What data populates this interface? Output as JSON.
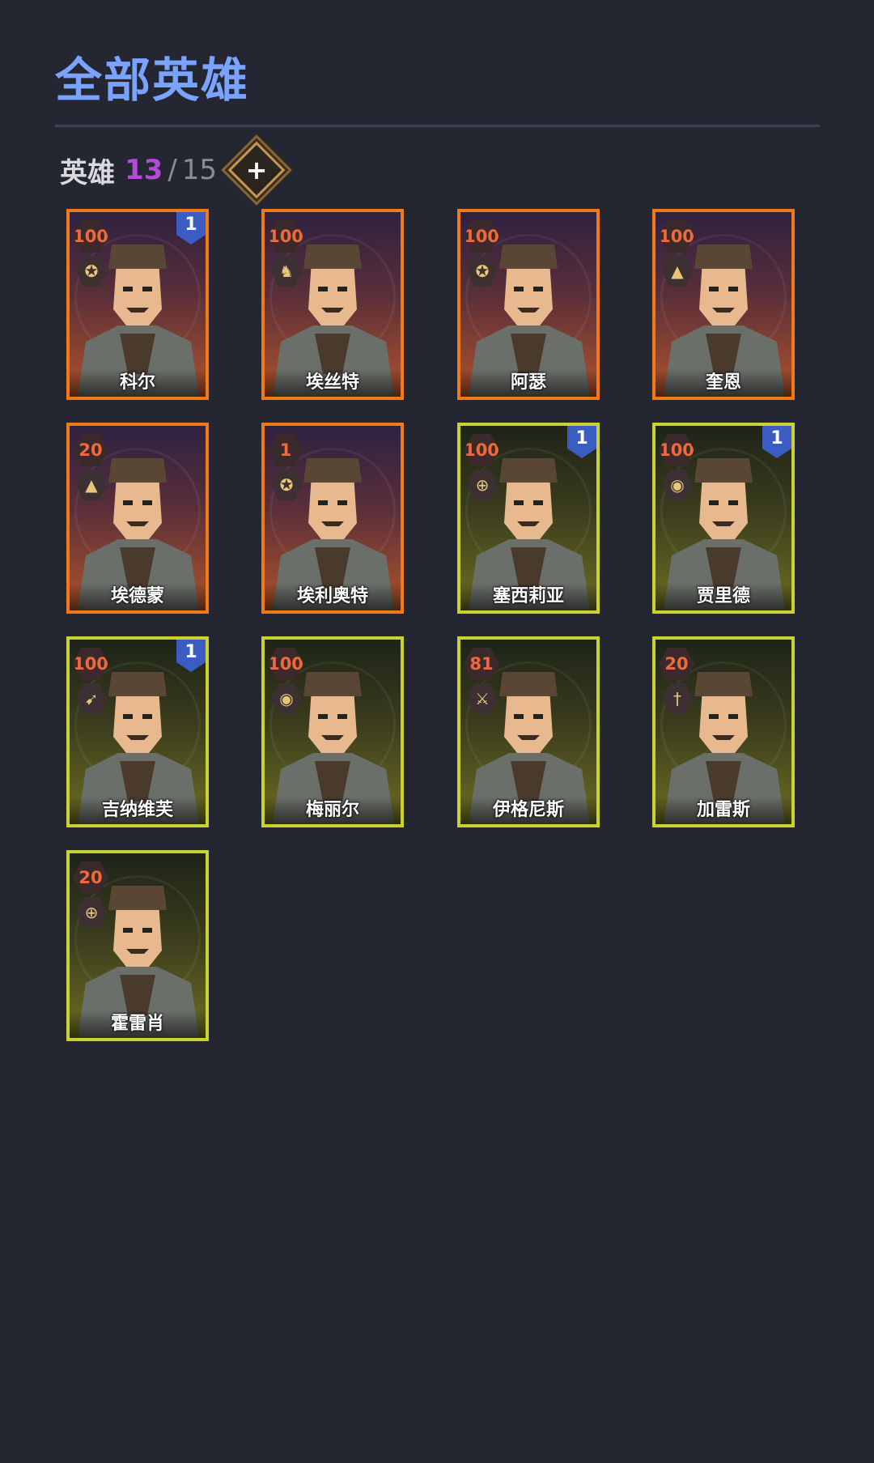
{
  "header": {
    "title": "全部英雄"
  },
  "roster": {
    "label": "英雄",
    "current": "13",
    "separator": "/",
    "max": "15",
    "add_icon": "plus-diamond-icon"
  },
  "heroes": [
    {
      "name": "科尔",
      "level": "100",
      "rarity": "orange",
      "class_icon": "pentagram-icon",
      "badge": "1"
    },
    {
      "name": "埃丝特",
      "level": "100",
      "rarity": "orange",
      "class_icon": "horse-icon",
      "badge": ""
    },
    {
      "name": "阿瑟",
      "level": "100",
      "rarity": "orange",
      "class_icon": "pentagram-icon",
      "badge": ""
    },
    {
      "name": "奎恩",
      "level": "100",
      "rarity": "orange",
      "class_icon": "wizard-hat-icon",
      "badge": ""
    },
    {
      "name": "埃德蒙",
      "level": "20",
      "rarity": "orange",
      "class_icon": "wizard-hat-icon",
      "badge": ""
    },
    {
      "name": "埃利奥特",
      "level": "1",
      "rarity": "orange",
      "class_icon": "pentagram-icon",
      "badge": ""
    },
    {
      "name": "塞西莉亚",
      "level": "100",
      "rarity": "green",
      "class_icon": "cross-icon",
      "badge": "1"
    },
    {
      "name": "贾里德",
      "level": "100",
      "rarity": "green",
      "class_icon": "eye-icon",
      "badge": "1"
    },
    {
      "name": "吉纳维芙",
      "level": "100",
      "rarity": "green",
      "class_icon": "arrows-icon",
      "badge": "1"
    },
    {
      "name": "梅丽尔",
      "level": "100",
      "rarity": "green",
      "class_icon": "eye-icon",
      "badge": ""
    },
    {
      "name": "伊格尼斯",
      "level": "81",
      "rarity": "green",
      "class_icon": "sword-icon",
      "badge": ""
    },
    {
      "name": "加雷斯",
      "level": "20",
      "rarity": "green",
      "class_icon": "dagger-icon",
      "badge": ""
    },
    {
      "name": "霍雷肖",
      "level": "20",
      "rarity": "green",
      "class_icon": "cross-icon",
      "badge": ""
    }
  ],
  "colors": {
    "orange_frame": "#f07a18",
    "green_frame": "#c9d22e",
    "title": "#7aa3ff",
    "count_current": "#b24bd8",
    "badge": "#3b5cc2"
  }
}
